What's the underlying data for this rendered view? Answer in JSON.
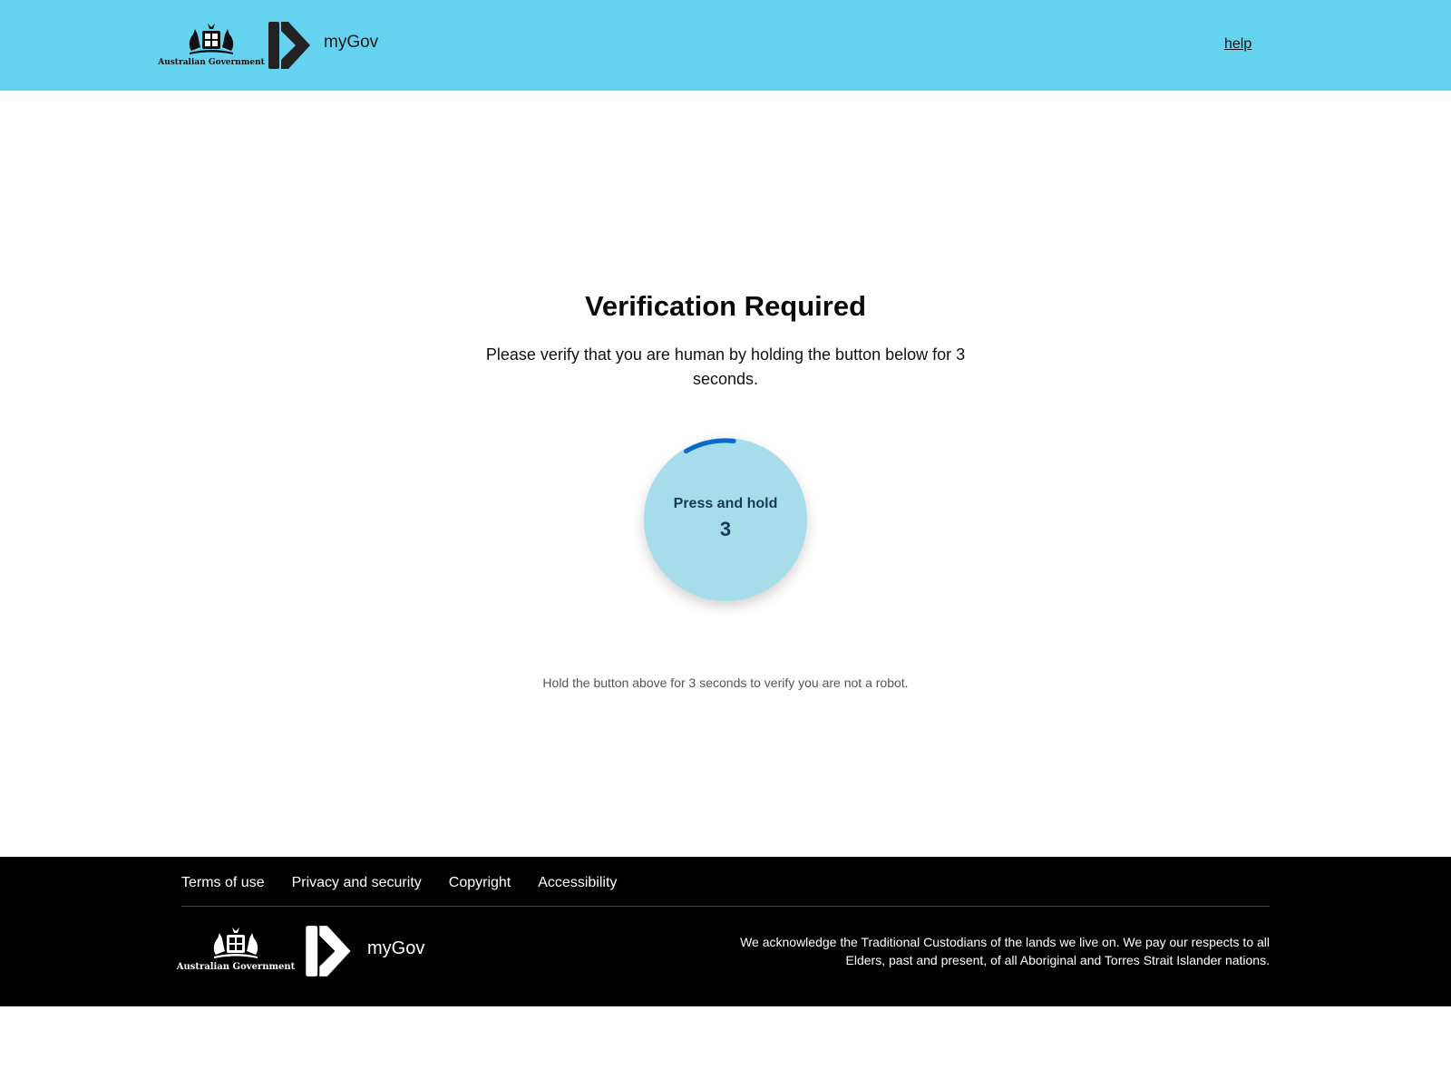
{
  "header": {
    "gov_label": "Australian Government",
    "brand": "myGov",
    "help_label": "help"
  },
  "main": {
    "title": "Verification Required",
    "description": "Please verify that you are human by holding the button below for 3 seconds.",
    "hold_button": {
      "label": "Press and hold",
      "countdown": "3",
      "progress": 0.1
    },
    "hint": "Hold the button above for 3 seconds to verify you are not a robot."
  },
  "footer": {
    "links": [
      "Terms of use",
      "Privacy and security",
      "Copyright",
      "Accessibility"
    ],
    "gov_label": "Australian Government",
    "brand": "myGov",
    "acknowledgement": "We acknowledge the Traditional Custodians of the lands we live on. We pay our respects to all Elders, past and present, of all Aboriginal and Torres Strait Islander nations."
  },
  "colors": {
    "header_bg": "#65d3ef",
    "button_bg": "#a7dcea",
    "progress_ring": "#0a6acb",
    "footer_bg": "#000000"
  }
}
